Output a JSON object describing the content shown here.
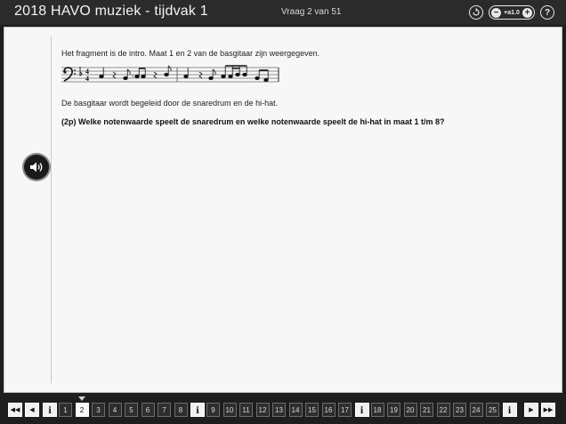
{
  "header": {
    "title": "2018 HAVO muziek - tijdvak 1",
    "question_counter": "Vraag 2 van 51",
    "zoom_label": "+a1.0",
    "back_icon": "back-circle-icon",
    "help_label": "?"
  },
  "content": {
    "intro": "Het fragment is de intro. Maat 1 en 2 van de basgitaar zijn weergegeven.",
    "time_signature": [
      "4",
      "4"
    ],
    "paragraph": "De basgitaar wordt begeleid door de snaredrum en de hi-hat.",
    "question": "(2p) Welke notenwaarde speelt de snaredrum en welke notenwaarde speelt de hi-hat in maat 1 t/m 8?"
  },
  "audio": {
    "icon": "speaker-icon"
  },
  "navigation": {
    "first_label": "◀◀",
    "prev_label": "◀",
    "next_label": "▶",
    "last_label": "▶▶",
    "info_label": "i",
    "current_question": "2",
    "items": [
      {
        "type": "info",
        "label": "i"
      },
      {
        "type": "num",
        "label": "1"
      },
      {
        "type": "num",
        "label": "2"
      },
      {
        "type": "num",
        "label": "3"
      },
      {
        "type": "num",
        "label": "4"
      },
      {
        "type": "num",
        "label": "5"
      },
      {
        "type": "num",
        "label": "6"
      },
      {
        "type": "num",
        "label": "7"
      },
      {
        "type": "num",
        "label": "8"
      },
      {
        "type": "info",
        "label": "i"
      },
      {
        "type": "num",
        "label": "9"
      },
      {
        "type": "num",
        "label": "10"
      },
      {
        "type": "num",
        "label": "11"
      },
      {
        "type": "num",
        "label": "12"
      },
      {
        "type": "num",
        "label": "13"
      },
      {
        "type": "num",
        "label": "14"
      },
      {
        "type": "num",
        "label": "15"
      },
      {
        "type": "num",
        "label": "16"
      },
      {
        "type": "num",
        "label": "17"
      },
      {
        "type": "info",
        "label": "i"
      },
      {
        "type": "num",
        "label": "18"
      },
      {
        "type": "num",
        "label": "19"
      },
      {
        "type": "num",
        "label": "20"
      },
      {
        "type": "num",
        "label": "21"
      },
      {
        "type": "num",
        "label": "22"
      },
      {
        "type": "num",
        "label": "23"
      },
      {
        "type": "num",
        "label": "24"
      },
      {
        "type": "num",
        "label": "25"
      },
      {
        "type": "info",
        "label": "i"
      }
    ]
  }
}
